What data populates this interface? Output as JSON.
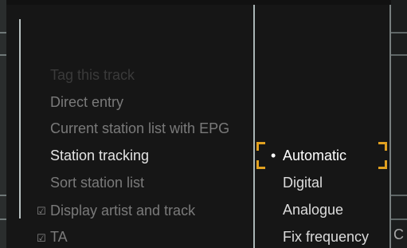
{
  "menu": {
    "items": [
      {
        "label": "Tag this track",
        "state": "disabled"
      },
      {
        "label": "Direct entry",
        "state": "normal"
      },
      {
        "label": "Current station list with EPG",
        "state": "normal"
      },
      {
        "label": "Station tracking",
        "state": "active"
      },
      {
        "label": "Sort station list",
        "state": "normal"
      },
      {
        "label": "Display artist and track",
        "state": "normal",
        "checkbox": "☑"
      },
      {
        "label": "TA",
        "state": "normal",
        "checkbox": "☑"
      }
    ]
  },
  "submenu": {
    "bullet": "•",
    "options": [
      {
        "label": "Automatic",
        "selected": true
      },
      {
        "label": "Digital",
        "selected": false
      },
      {
        "label": "Analogue",
        "selected": false
      },
      {
        "label": "Fix frequency",
        "selected": false
      }
    ]
  },
  "edge_text": "C",
  "colors": {
    "highlight": "#e0a020"
  }
}
